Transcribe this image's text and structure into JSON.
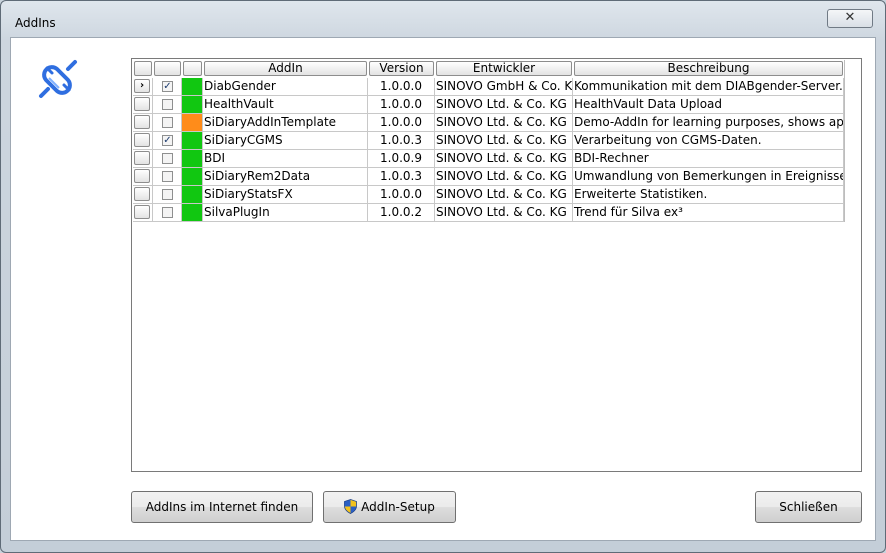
{
  "window": {
    "title": "AddIns",
    "close_glyph": "✕"
  },
  "columns": {
    "addin": "AddIn",
    "version": "Version",
    "developer": "Entwickler",
    "description": "Beschreibung"
  },
  "status_colors": {
    "active": "#11c711",
    "inactive": "#ff8c1a"
  },
  "rows": [
    {
      "selected": true,
      "checked": true,
      "status": "active",
      "name": "DiabGender",
      "version": "1.0.0.0",
      "developer": "SINOVO GmbH & Co. KG",
      "description": "Kommunikation mit dem DIABgender-Server."
    },
    {
      "selected": false,
      "checked": false,
      "status": "active",
      "name": "HealthVault",
      "version": "1.0.0.0",
      "developer": "SINOVO Ltd. & Co. KG",
      "description": "HealthVault Data Upload"
    },
    {
      "selected": false,
      "checked": false,
      "status": "inactive",
      "name": "SiDiaryAddInTemplate",
      "version": "1.0.0.0",
      "developer": "SINOVO Ltd. & Co. KG",
      "description": "Demo-AddIn for learning purposes, shows appl"
    },
    {
      "selected": false,
      "checked": true,
      "status": "active",
      "name": "SiDiaryCGMS",
      "version": "1.0.0.3",
      "developer": "SINOVO Ltd. & Co. KG",
      "description": "Verarbeitung von CGMS-Daten."
    },
    {
      "selected": false,
      "checked": false,
      "status": "active",
      "name": "BDI",
      "version": "1.0.0.9",
      "developer": "SINOVO Ltd. & Co. KG",
      "description": "BDI-Rechner"
    },
    {
      "selected": false,
      "checked": false,
      "status": "active",
      "name": "SiDiaryRem2Data",
      "version": "1.0.0.3",
      "developer": "SINOVO Ltd. & Co. KG",
      "description": "Umwandlung von Bemerkungen in Ereignisse, D"
    },
    {
      "selected": false,
      "checked": false,
      "status": "active",
      "name": "SiDiaryStatsFX",
      "version": "1.0.0.0",
      "developer": "SINOVO Ltd. & Co. KG",
      "description": "Erweiterte Statistiken."
    },
    {
      "selected": false,
      "checked": false,
      "status": "active",
      "name": "SilvaPlugIn",
      "version": "1.0.0.2",
      "developer": "SINOVO Ltd. & Co. KG",
      "description": "Trend für Silva ex³"
    }
  ],
  "buttons": {
    "find_online": "AddIns im Internet finden",
    "setup": "AddIn-Setup",
    "close": "Schließen"
  },
  "icons": {
    "app": "plugin-plug-icon",
    "setup": "uac-shield-icon",
    "row_selector": "row-pointer-icon",
    "check_glyph": "✓",
    "pointer_glyph": "›"
  }
}
